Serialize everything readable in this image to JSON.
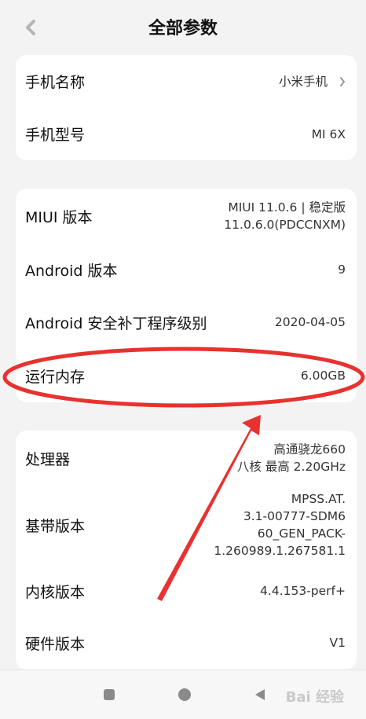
{
  "header": {
    "title": "全部参数",
    "back_icon": "chevron-left-icon"
  },
  "card1": {
    "phone_name": {
      "label": "手机名称",
      "value": "小米手机"
    },
    "phone_model": {
      "label": "手机型号",
      "value": "MI 6X"
    }
  },
  "card2": {
    "miui": {
      "label": "MIUI 版本",
      "value_line1": "MIUI 11.0.6 | 稳定版",
      "value_line2": "11.0.6.0(PDCCNXM)"
    },
    "android": {
      "label": "Android 版本",
      "value": "9"
    },
    "patch": {
      "label": "Android 安全补丁程序级别",
      "value": "2020-04-05"
    },
    "ram": {
      "label": "运行内存",
      "value": "6.00GB"
    }
  },
  "card3": {
    "cpu": {
      "label": "处理器",
      "value_line1": "高通骁龙660",
      "value_line2": "八核 最高 2.20GHz"
    },
    "baseband": {
      "label": "基带版本",
      "value_lines": [
        "MPSS.AT.",
        "3.1-00777-SDM6",
        "60_GEN_PACK-",
        "1.260989.1.267581.1"
      ]
    },
    "kernel": {
      "label": "内核版本",
      "value": "4.4.153-perf+"
    },
    "hardware": {
      "label": "硬件版本",
      "value": "V1"
    }
  },
  "annotation": {
    "color": "#e8322f"
  },
  "navbar": {
    "watermark": "Bai 经验"
  }
}
